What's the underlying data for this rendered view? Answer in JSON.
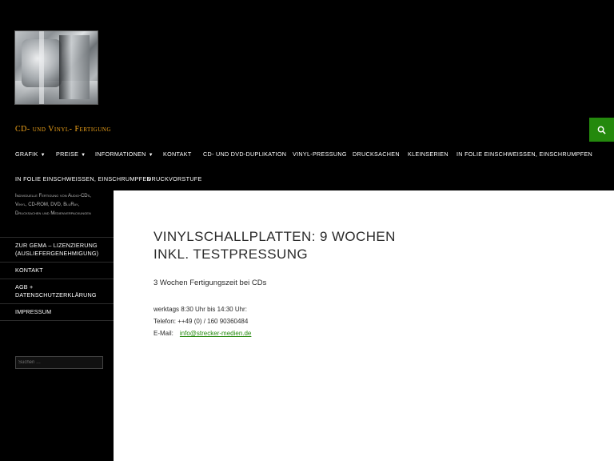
{
  "site": {
    "title": "CD- und Vinyl- Fertigung",
    "tagline": "Individuelle Fertigung von Audio-CDs, Vinyl, CD-ROM, DVD, BluRay, Drucksachen und Medienverpackungen"
  },
  "nav": {
    "row1": [
      {
        "label": "Grafik",
        "has_dropdown": true
      },
      {
        "label": "Preise",
        "has_dropdown": true
      },
      {
        "label": "Informationen",
        "has_dropdown": true
      },
      {
        "label": "Kontakt",
        "has_dropdown": false
      },
      {
        "label": "CD- und DVD-Duplikation",
        "has_dropdown": false
      },
      {
        "label": "Vinyl-Pressung",
        "has_dropdown": false
      },
      {
        "label": "Drucksachen",
        "has_dropdown": false
      },
      {
        "label": "Kleinserien",
        "has_dropdown": false
      },
      {
        "label": "In Folie einschweissen, einschrumpfen",
        "has_dropdown": false
      }
    ],
    "row2": [
      {
        "label": "In Folie einschweissen, einschrumpfen",
        "has_dropdown": false
      },
      {
        "label": "Druckvorstufe",
        "has_dropdown": false
      }
    ]
  },
  "sidebar": {
    "items": [
      {
        "label": "Zur GEMA – Lizenzierung (Ausliefergenehmigung)"
      },
      {
        "label": "Kontakt"
      },
      {
        "label": "AGB + Datenschutzerklärung"
      },
      {
        "label": "Impressum"
      }
    ],
    "search_placeholder": "Suchen …"
  },
  "main": {
    "title": "Vinylschallplatten: 9 Wochen inkl. Testpressung",
    "subline": "3 Wochen Fertigungszeit bei CDs",
    "hours": "werktags 8:30 Uhr bis 14:30 Uhr:",
    "phone": "Telefon: ++49 (0) / 160 90360484",
    "email_label": "E-Mail:",
    "email": "info@strecker-medien.de"
  },
  "colors": {
    "accent": "#24890d",
    "site_title": "#f2a51a",
    "background": "#000000"
  },
  "icons": {
    "search": "search-icon",
    "dropdown": "caret-down-icon"
  }
}
